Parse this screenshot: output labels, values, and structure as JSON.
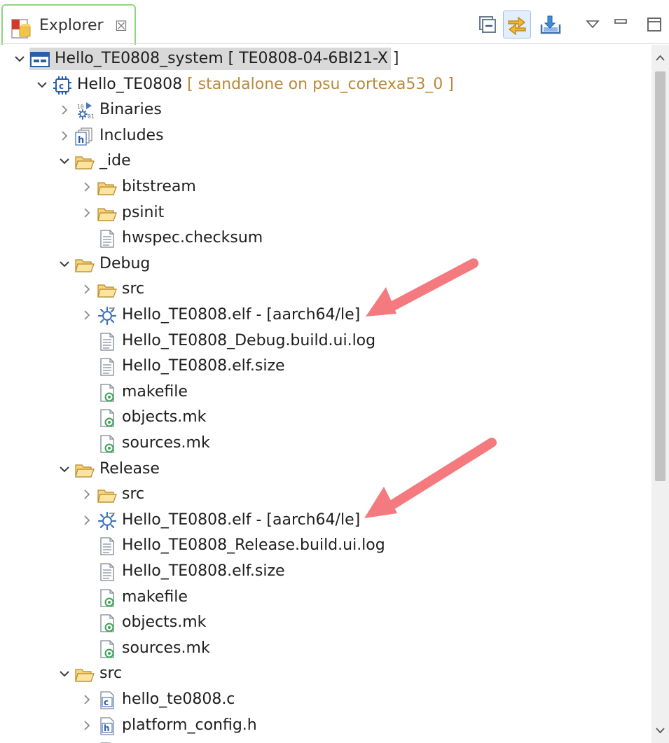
{
  "view": {
    "tab_label": "Explorer",
    "tab_close_glyph": "☒",
    "toolbar": [
      {
        "name": "collapse-all-button",
        "icon": "collapse-all-icon"
      },
      {
        "name": "link-with-editor-button",
        "icon": "link-with-editor-icon",
        "active": true
      },
      {
        "name": "import-button",
        "icon": "import-icon"
      },
      {
        "name": "view-menu-button",
        "icon": "view-menu-icon"
      },
      {
        "name": "minimize-button",
        "icon": "minimize-icon"
      },
      {
        "name": "maximize-button",
        "icon": "maximize-icon"
      }
    ]
  },
  "tree": [
    {
      "depth": 0,
      "expanded": true,
      "icon": "system-project-icon",
      "label": "Hello_TE0808_system [ TE0808-04-6BI21-X ]",
      "selected": true
    },
    {
      "depth": 1,
      "expanded": true,
      "icon": "c-project-icon",
      "label": "Hello_TE0808",
      "extra": "[ standalone on psu_cortexa53_0 ]"
    },
    {
      "depth": 2,
      "expanded": false,
      "icon": "binaries-icon",
      "label": "Binaries"
    },
    {
      "depth": 2,
      "expanded": false,
      "icon": "includes-icon",
      "label": "Includes"
    },
    {
      "depth": 2,
      "expanded": true,
      "icon": "folder-icon",
      "label": "_ide"
    },
    {
      "depth": 3,
      "expanded": false,
      "icon": "folder-icon",
      "label": "bitstream"
    },
    {
      "depth": 3,
      "expanded": false,
      "icon": "folder-icon",
      "label": "psinit"
    },
    {
      "depth": 3,
      "expanded": null,
      "icon": "text-file-icon",
      "label": "hwspec.checksum"
    },
    {
      "depth": 2,
      "expanded": true,
      "icon": "folder-icon",
      "label": "Debug"
    },
    {
      "depth": 3,
      "expanded": false,
      "icon": "folder-icon",
      "label": "src"
    },
    {
      "depth": 3,
      "expanded": false,
      "icon": "elf-binary-icon",
      "label": "Hello_TE0808.elf - [aarch64/le]"
    },
    {
      "depth": 3,
      "expanded": null,
      "icon": "text-file-icon",
      "label": "Hello_TE0808_Debug.build.ui.log"
    },
    {
      "depth": 3,
      "expanded": null,
      "icon": "text-file-icon",
      "label": "Hello_TE0808.elf.size"
    },
    {
      "depth": 3,
      "expanded": null,
      "icon": "makefile-icon",
      "label": "makefile"
    },
    {
      "depth": 3,
      "expanded": null,
      "icon": "makefile-icon",
      "label": "objects.mk"
    },
    {
      "depth": 3,
      "expanded": null,
      "icon": "makefile-icon",
      "label": "sources.mk"
    },
    {
      "depth": 2,
      "expanded": true,
      "icon": "folder-icon",
      "label": "Release"
    },
    {
      "depth": 3,
      "expanded": false,
      "icon": "folder-icon",
      "label": "src"
    },
    {
      "depth": 3,
      "expanded": false,
      "icon": "elf-binary-icon",
      "label": "Hello_TE0808.elf - [aarch64/le]"
    },
    {
      "depth": 3,
      "expanded": null,
      "icon": "text-file-icon",
      "label": "Hello_TE0808_Release.build.ui.log"
    },
    {
      "depth": 3,
      "expanded": null,
      "icon": "text-file-icon",
      "label": "Hello_TE0808.elf.size"
    },
    {
      "depth": 3,
      "expanded": null,
      "icon": "makefile-icon",
      "label": "makefile"
    },
    {
      "depth": 3,
      "expanded": null,
      "icon": "makefile-icon",
      "label": "objects.mk"
    },
    {
      "depth": 3,
      "expanded": null,
      "icon": "makefile-icon",
      "label": "sources.mk"
    },
    {
      "depth": 2,
      "expanded": true,
      "icon": "folder-icon",
      "label": "src"
    },
    {
      "depth": 3,
      "expanded": false,
      "icon": "c-source-file-icon",
      "label": "hello_te0808.c"
    },
    {
      "depth": 3,
      "expanded": false,
      "icon": "c-header-file-icon",
      "label": "platform_config.h"
    },
    {
      "depth": 3,
      "expanded": false,
      "icon": "c-source-file-icon",
      "label": ""
    }
  ],
  "annotations": {
    "arrow_color": "#f47a7f",
    "arrow_targets": [
      "Debug elf",
      "Release elf"
    ]
  },
  "colors": {
    "tab_border": "#8fd47e",
    "selection": "#d9d9d9",
    "decoration_text": "#b88a3a",
    "folder": "#e8b84a"
  }
}
